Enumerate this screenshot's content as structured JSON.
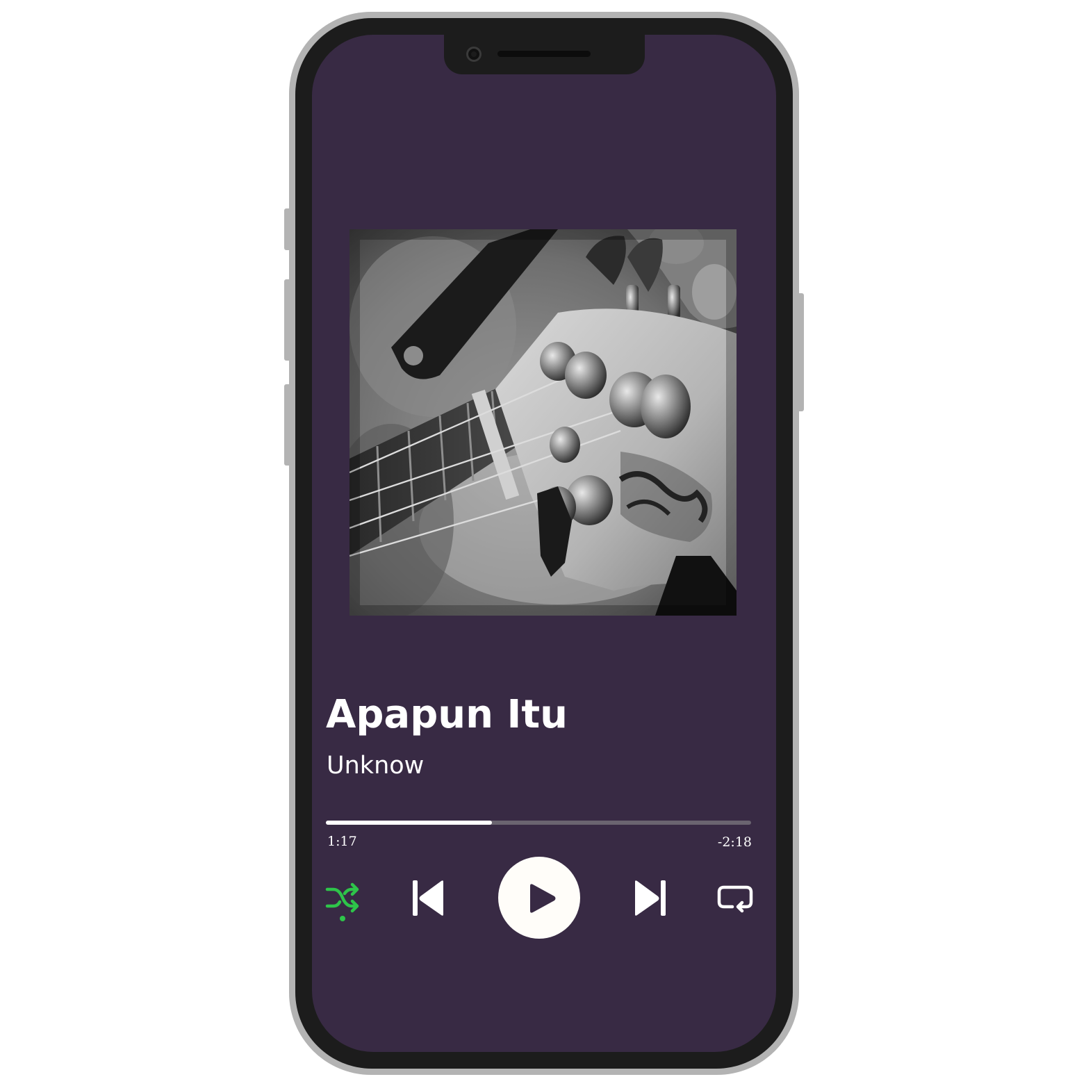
{
  "track": {
    "title": "Apapun Itu",
    "artist": "Unknow"
  },
  "playback": {
    "elapsed": "1:17",
    "remaining": "-2:18",
    "progress_fraction": 0.39,
    "shuffle_active": true
  },
  "controls": {
    "shuffle_icon": "shuffle-icon",
    "previous_icon": "skip-previous-icon",
    "play_icon": "play-icon",
    "next_icon": "skip-next-icon",
    "repeat_icon": "repeat-icon"
  },
  "colors": {
    "screen_background": "#382a44",
    "accent_green": "#2ec44a",
    "text": "#ffffff",
    "progress_track": "#6a6470"
  }
}
